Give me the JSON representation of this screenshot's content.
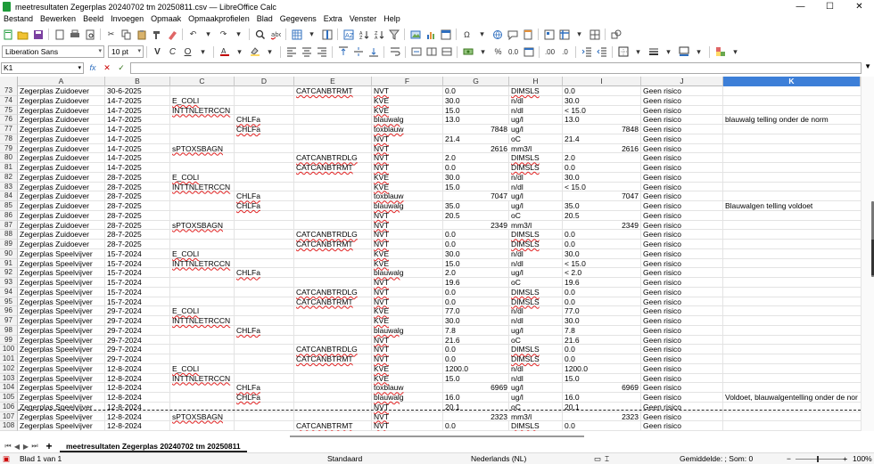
{
  "window": {
    "title": "meetresultaten Zegerplas 20240702 tm 20250811.csv — LibreOffice Calc",
    "minimize": "—",
    "maximize": "☐",
    "close": "✕"
  },
  "menu": [
    "Bestand",
    "Bewerken",
    "Beeld",
    "Invoegen",
    "Opmaak",
    "Opmaakprofielen",
    "Blad",
    "Gegevens",
    "Extra",
    "Venster",
    "Help"
  ],
  "toolbar": {
    "font_name": "Liberation Sans",
    "font_size": "10 pt",
    "bold": "V",
    "italic": "C",
    "underline": "O",
    "percent": "%",
    "decimals": "0.0",
    "add_decimal": ".00",
    "remove_decimal": ".0"
  },
  "formula_bar": {
    "name_box": "K1",
    "fx": "fx",
    "cancel": "✕",
    "accept": "✓",
    "value": ""
  },
  "columns": [
    "A",
    "B",
    "C",
    "D",
    "E",
    "F",
    "G",
    "H",
    "I",
    "J",
    "K"
  ],
  "selected_column": "K",
  "rows": [
    {
      "n": "73",
      "c": [
        "Zegerplas Zuidoever",
        "30-6-2025",
        "",
        "",
        "CATCANBTRMT",
        "NVT",
        "0.0",
        "",
        "DIMSLS",
        "0.0",
        "Geen risico",
        ""
      ]
    },
    {
      "n": "74",
      "c": [
        "Zegerplas Zuidoever",
        "14-7-2025",
        "E_COLI",
        "",
        "",
        "KVE",
        "30.0",
        "",
        "n/dl",
        "30.0",
        "Geen risico",
        ""
      ]
    },
    {
      "n": "75",
      "c": [
        "Zegerplas Zuidoever",
        "14-7-2025",
        "INTTNLETRCCN",
        "",
        "",
        "KVE",
        "15.0",
        "",
        "n/dl",
        "< 15.0",
        "Geen risico",
        ""
      ]
    },
    {
      "n": "76",
      "c": [
        "Zegerplas Zuidoever",
        "14-7-2025",
        "",
        "CHLFa",
        "",
        "blauwalg",
        "13.0",
        "",
        "ug/l",
        "13.0",
        "Geen risico",
        "blauwalg telling onder de norm"
      ]
    },
    {
      "n": "77",
      "c": [
        "Zegerplas Zuidoever",
        "14-7-2025",
        "",
        "CHLFa",
        "",
        "toxblauw",
        "",
        "7848",
        "ug/l",
        "7848",
        "Geen risico",
        ""
      ]
    },
    {
      "n": "78",
      "c": [
        "Zegerplas Zuidoever",
        "14-7-2025",
        "",
        "",
        "",
        "NVT",
        "21.4",
        "",
        "oC",
        "21.4",
        "Geen risico",
        ""
      ]
    },
    {
      "n": "79",
      "c": [
        "Zegerplas Zuidoever",
        "14-7-2025",
        "sPTOXSBAGN",
        "",
        "",
        "NVT",
        "",
        "2616",
        "mm3/l",
        "2616",
        "Geen risico",
        ""
      ]
    },
    {
      "n": "80",
      "c": [
        "Zegerplas Zuidoever",
        "14-7-2025",
        "",
        "",
        "CATCANBTRDLG",
        "NVT",
        "2.0",
        "",
        "DIMSLS",
        "2.0",
        "Geen risico",
        ""
      ]
    },
    {
      "n": "81",
      "c": [
        "Zegerplas Zuidoever",
        "14-7-2025",
        "",
        "",
        "CATCANBTRMT",
        "NVT",
        "0.0",
        "",
        "DIMSLS",
        "0.0",
        "Geen risico",
        ""
      ]
    },
    {
      "n": "82",
      "c": [
        "Zegerplas Zuidoever",
        "28-7-2025",
        "E_COLI",
        "",
        "",
        "KVE",
        "30.0",
        "",
        "n/dl",
        "30.0",
        "Geen risico",
        ""
      ]
    },
    {
      "n": "83",
      "c": [
        "Zegerplas Zuidoever",
        "28-7-2025",
        "INTTNLETRCCN",
        "",
        "",
        "KVE",
        "15.0",
        "",
        "n/dl",
        "< 15.0",
        "Geen risico",
        ""
      ]
    },
    {
      "n": "84",
      "c": [
        "Zegerplas Zuidoever",
        "28-7-2025",
        "",
        "CHLFa",
        "",
        "toxblauw",
        "",
        "7047",
        "ug/l",
        "7047",
        "Geen risico",
        ""
      ]
    },
    {
      "n": "85",
      "c": [
        "Zegerplas Zuidoever",
        "28-7-2025",
        "",
        "CHLFa",
        "",
        "blauwalg",
        "35.0",
        "",
        "ug/l",
        "35.0",
        "Geen risico",
        "Blauwalgen telling voldoet"
      ]
    },
    {
      "n": "86",
      "c": [
        "Zegerplas Zuidoever",
        "28-7-2025",
        "",
        "",
        "",
        "NVT",
        "20.5",
        "",
        "oC",
        "20.5",
        "Geen risico",
        ""
      ]
    },
    {
      "n": "87",
      "c": [
        "Zegerplas Zuidoever",
        "28-7-2025",
        "sPTOXSBAGN",
        "",
        "",
        "NVT",
        "",
        "2349",
        "mm3/l",
        "2349",
        "Geen risico",
        ""
      ]
    },
    {
      "n": "88",
      "c": [
        "Zegerplas Zuidoever",
        "28-7-2025",
        "",
        "",
        "CATCANBTRDLG",
        "NVT",
        "0.0",
        "",
        "DIMSLS",
        "0.0",
        "Geen risico",
        ""
      ]
    },
    {
      "n": "89",
      "c": [
        "Zegerplas Zuidoever",
        "28-7-2025",
        "",
        "",
        "CATCANBTRMT",
        "NVT",
        "0.0",
        "",
        "DIMSLS",
        "0.0",
        "Geen risico",
        ""
      ]
    },
    {
      "n": "90",
      "c": [
        "Zegerplas Speelvijver",
        "15-7-2024",
        "E_COLI",
        "",
        "",
        "KVE",
        "30.0",
        "",
        "n/dl",
        "30.0",
        "Geen risico",
        ""
      ]
    },
    {
      "n": "91",
      "c": [
        "Zegerplas Speelvijver",
        "15-7-2024",
        "INTTNLETRCCN",
        "",
        "",
        "KVE",
        "15.0",
        "",
        "n/dl",
        "< 15.0",
        "Geen risico",
        ""
      ]
    },
    {
      "n": "92",
      "c": [
        "Zegerplas Speelvijver",
        "15-7-2024",
        "",
        "CHLFa",
        "",
        "blauwalg",
        "2.0",
        "",
        "ug/l",
        "< 2.0",
        "Geen risico",
        ""
      ]
    },
    {
      "n": "93",
      "c": [
        "Zegerplas Speelvijver",
        "15-7-2024",
        "",
        "",
        "",
        "NVT",
        "19.6",
        "",
        "oC",
        "19.6",
        "Geen risico",
        ""
      ]
    },
    {
      "n": "94",
      "c": [
        "Zegerplas Speelvijver",
        "15-7-2024",
        "",
        "",
        "CATCANBTRDLG",
        "NVT",
        "0.0",
        "",
        "DIMSLS",
        "0.0",
        "Geen risico",
        ""
      ]
    },
    {
      "n": "95",
      "c": [
        "Zegerplas Speelvijver",
        "15-7-2024",
        "",
        "",
        "CATCANBTRMT",
        "NVT",
        "0.0",
        "",
        "DIMSLS",
        "0.0",
        "Geen risico",
        ""
      ]
    },
    {
      "n": "96",
      "c": [
        "Zegerplas Speelvijver",
        "29-7-2024",
        "E_COLI",
        "",
        "",
        "KVE",
        "77.0",
        "",
        "n/dl",
        "77.0",
        "Geen risico",
        ""
      ]
    },
    {
      "n": "97",
      "c": [
        "Zegerplas Speelvijver",
        "29-7-2024",
        "INTTNLETRCCN",
        "",
        "",
        "KVE",
        "30.0",
        "",
        "n/dl",
        "30.0",
        "Geen risico",
        ""
      ]
    },
    {
      "n": "98",
      "c": [
        "Zegerplas Speelvijver",
        "29-7-2024",
        "",
        "CHLFa",
        "",
        "blauwalg",
        "7.8",
        "",
        "ug/l",
        "7.8",
        "Geen risico",
        ""
      ]
    },
    {
      "n": "99",
      "c": [
        "Zegerplas Speelvijver",
        "29-7-2024",
        "",
        "",
        "",
        "NVT",
        "21.6",
        "",
        "oC",
        "21.6",
        "Geen risico",
        ""
      ]
    },
    {
      "n": "100",
      "c": [
        "Zegerplas Speelvijver",
        "29-7-2024",
        "",
        "",
        "CATCANBTRDLG",
        "NVT",
        "0.0",
        "",
        "DIMSLS",
        "0.0",
        "Geen risico",
        ""
      ]
    },
    {
      "n": "101",
      "c": [
        "Zegerplas Speelvijver",
        "29-7-2024",
        "",
        "",
        "CATCANBTRMT",
        "NVT",
        "0.0",
        "",
        "DIMSLS",
        "0.0",
        "Geen risico",
        ""
      ]
    },
    {
      "n": "102",
      "c": [
        "Zegerplas Speelvijver",
        "12-8-2024",
        "E_COLI",
        "",
        "",
        "KVE",
        "1200.0",
        "",
        "n/dl",
        "1200.0",
        "Geen risico",
        ""
      ]
    },
    {
      "n": "103",
      "c": [
        "Zegerplas Speelvijver",
        "12-8-2024",
        "INTTNLETRCCN",
        "",
        "",
        "KVE",
        "15.0",
        "",
        "n/dl",
        "15.0",
        "Geen risico",
        ""
      ]
    },
    {
      "n": "104",
      "c": [
        "Zegerplas Speelvijver",
        "12-8-2024",
        "",
        "CHLFa",
        "",
        "toxblauw",
        "",
        "6969",
        "ug/l",
        "6969",
        "Geen risico",
        ""
      ]
    },
    {
      "n": "105",
      "c": [
        "Zegerplas Speelvijver",
        "12-8-2024",
        "",
        "CHLFa",
        "",
        "blauwalg",
        "16.0",
        "",
        "ug/l",
        "16.0",
        "Geen risico",
        "Voldoet, blauwalgentelling onder de nor"
      ]
    },
    {
      "n": "106",
      "c": [
        "Zegerplas Speelvijver",
        "12-8-2024",
        "",
        "",
        "",
        "NVT",
        "20.1",
        "",
        "oC",
        "20.1",
        "Geen risico",
        ""
      ]
    },
    {
      "n": "107",
      "c": [
        "Zegerplas Speelvijver",
        "12-8-2024",
        "sPTOXSBAGN",
        "",
        "",
        "NVT",
        "",
        "2323",
        "mm3/l",
        "2323",
        "Geen risico",
        ""
      ]
    },
    {
      "n": "108",
      "c": [
        "Zegerplas Speelvijver",
        "12-8-2024",
        "",
        "",
        "CATCANBTRMT",
        "NVT",
        "0.0",
        "",
        "DIMSLS",
        "0.0",
        "Geen risico",
        ""
      ]
    }
  ],
  "sheet_tab": "meetresultaten Zegerplas 20240702 tm 20250811",
  "status": {
    "sheet": "Blad 1 van 1",
    "style": "Standaard",
    "language": "Nederlands (NL)",
    "summary": "Gemiddelde: ; Som: 0",
    "zoom": "100%",
    "zoom_minus": "−",
    "zoom_plus": "+"
  },
  "colors": {
    "selected_header": "#3d7fd8",
    "app_accent": "#1e9b3a"
  }
}
